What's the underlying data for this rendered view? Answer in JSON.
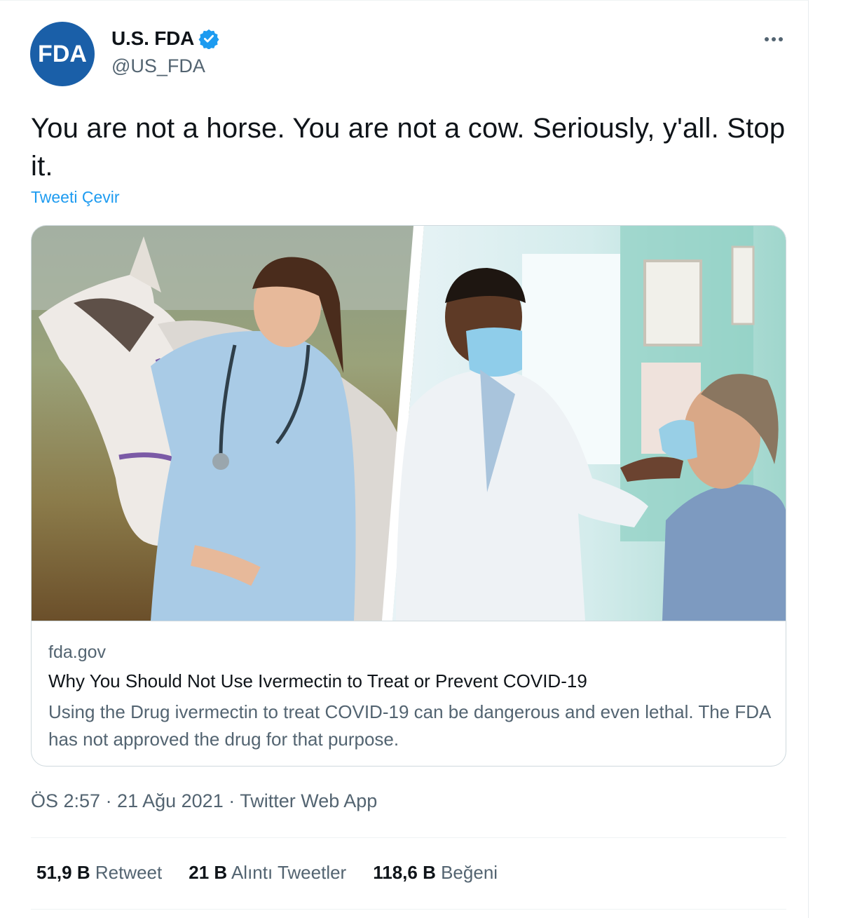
{
  "account": {
    "display_name": "U.S. FDA",
    "handle": "@US_FDA",
    "avatar_text": "FDA",
    "verified": true
  },
  "tweet": {
    "text": "You are not a horse. You are not a cow. Seriously, y'all. Stop it.",
    "translate_label": "Tweeti Çevir",
    "meta": "ÖS 2:57 · 21 Ağu 2021 · Twitter Web App"
  },
  "link_card": {
    "domain": "fda.gov",
    "title": "Why You Should Not Use Ivermectin to Treat or Prevent COVID-19",
    "description": "Using the Drug ivermectin to treat COVID-19 can be dangerous and even lethal. The FDA has not approved the drug for that purpose.",
    "image_left": "veterinarian-with-horse-photo",
    "image_right": "doctor-with-patient-masks-photo"
  },
  "stats": [
    {
      "count": "51,9 B",
      "label": "Retweet"
    },
    {
      "count": "21 B",
      "label": "Alıntı Tweetler"
    },
    {
      "count": "118,6 B",
      "label": "Beğeni"
    }
  ],
  "colors": {
    "brand_blue": "#1d9bf0",
    "fda_blue": "#1a5fa8",
    "text_primary": "#0f1419",
    "text_secondary": "#536471"
  },
  "icons": {
    "verified": "verified-badge-icon",
    "more": "more-horizontal-icon"
  }
}
